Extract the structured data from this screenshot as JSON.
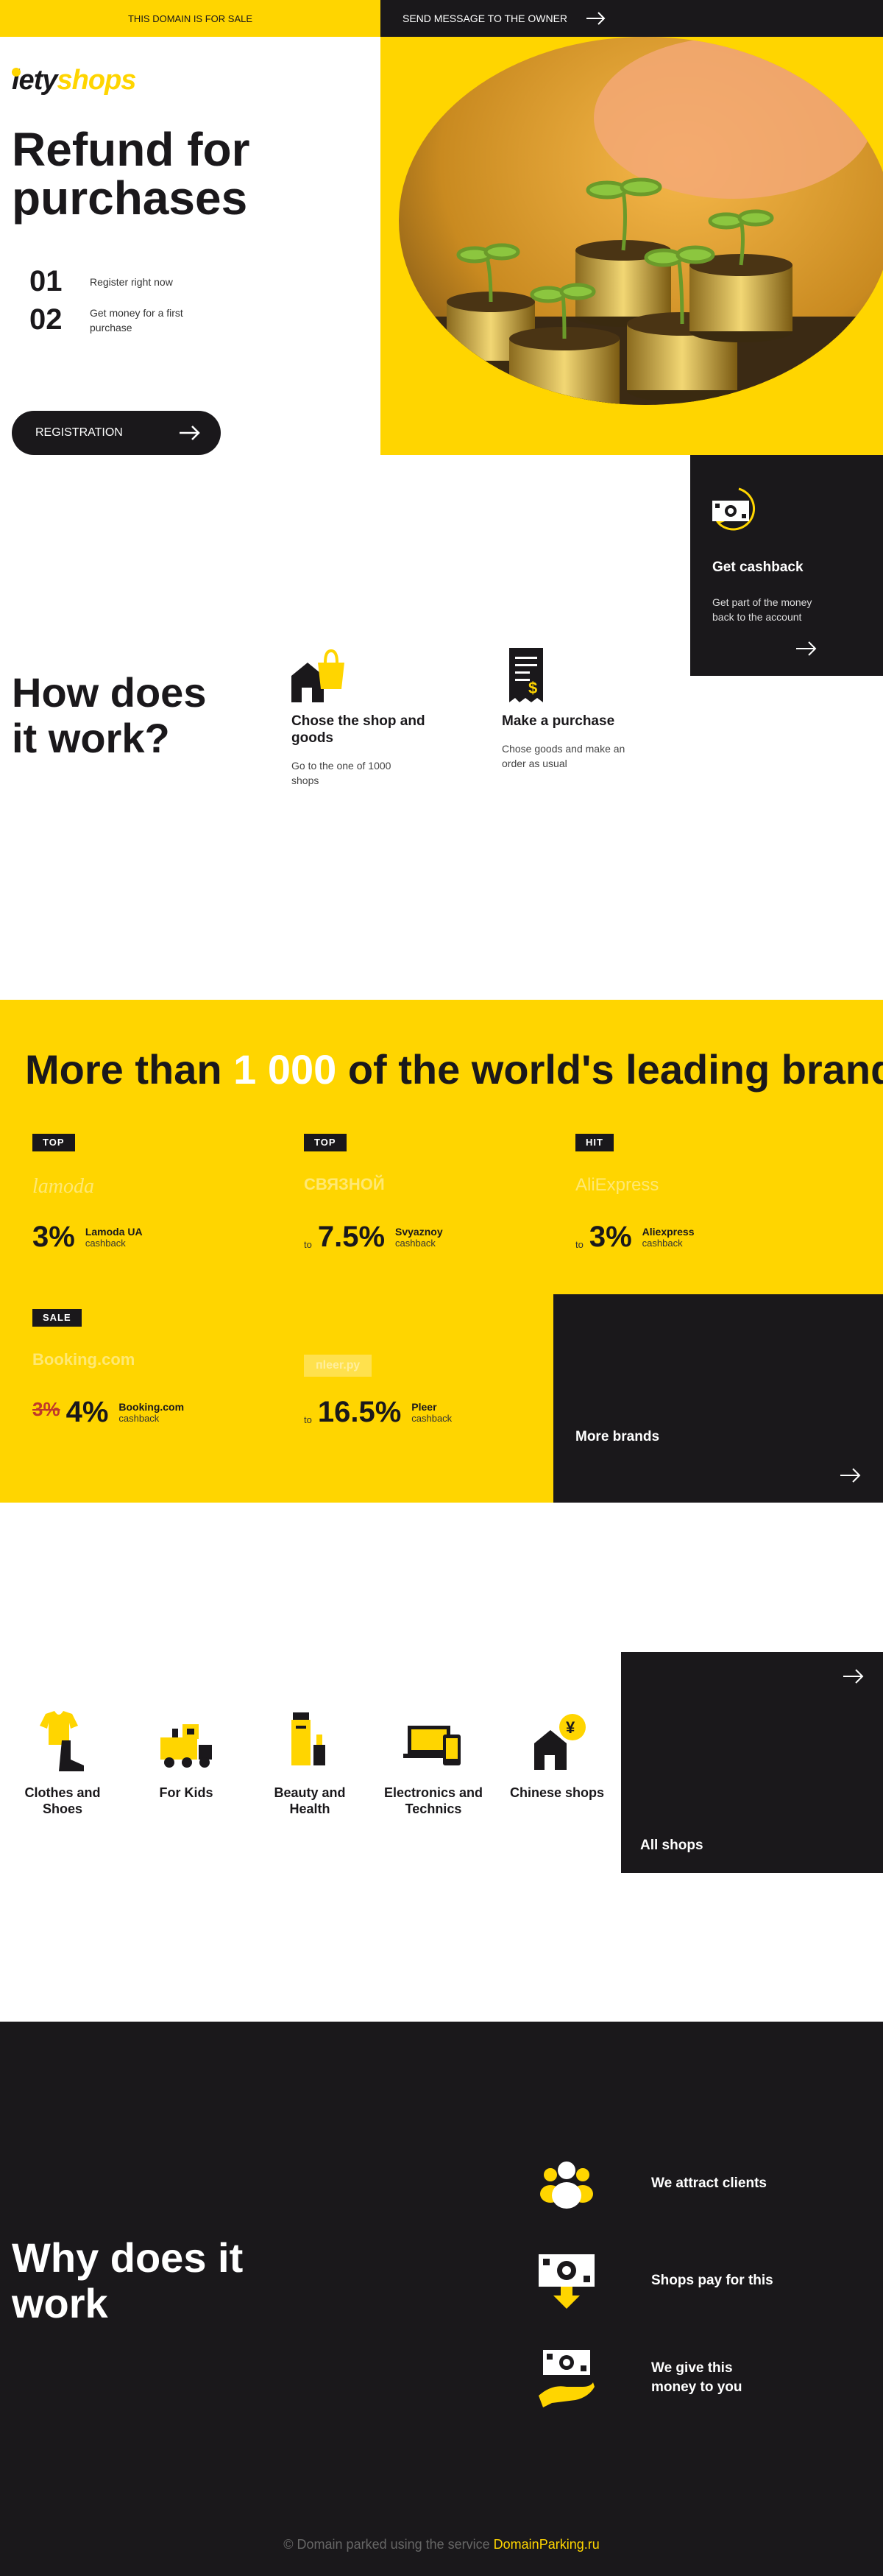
{
  "topbar": {
    "sale_text": "THIS DOMAIN IS FOR SALE",
    "message_text": "SEND MESSAGE TO THE OWNER"
  },
  "logo": {
    "part1": "lety",
    "part2": "shops"
  },
  "hero": {
    "title": "Refund for purchases",
    "steps": [
      {
        "num": "01",
        "text": "Register right now"
      },
      {
        "num": "02",
        "text": "Get money for a first purchase"
      }
    ],
    "button_label": "REGISTRATION"
  },
  "how": {
    "title": "How does it work?",
    "items": [
      {
        "title": "Chose the shop and goods",
        "desc": "Go to the one of 1000 shops"
      },
      {
        "title": "Make a purchase",
        "desc": "Chose goods and make an order as usual"
      },
      {
        "title": "Get cashback",
        "desc": "Get part of the money back to the account"
      }
    ]
  },
  "brands": {
    "title_before": "More than ",
    "title_highlight": "1 000",
    "title_after": " of the world's leading brand",
    "items": [
      {
        "badge": "TOP",
        "logo": "lamoda",
        "to": "",
        "old": "",
        "pct": "3%",
        "name": "Lamoda UA",
        "cashback": "cashback"
      },
      {
        "badge": "TOP",
        "logo": "СВЯЗНОЙ",
        "to": "to",
        "old": "",
        "pct": "7.5%",
        "name": "Svyaznoy",
        "cashback": "cashback"
      },
      {
        "badge": "HIT",
        "logo": "AliExpress",
        "to": "to",
        "old": "",
        "pct": "3%",
        "name": "Aliexpress",
        "cashback": "cashback"
      },
      {
        "badge": "SALE",
        "logo": "Booking.com",
        "to": "",
        "old": "3%",
        "pct": "4%",
        "name": "Booking.com",
        "cashback": "cashback"
      },
      {
        "badge": "",
        "logo": "пleer.ру",
        "to": "to",
        "old": "",
        "pct": "16.5%",
        "name": "Pleer",
        "cashback": "cashback"
      }
    ],
    "more_label": "More brands"
  },
  "categories": {
    "items": [
      {
        "label": "Clothes and Shoes",
        "icon": "clothes-icon"
      },
      {
        "label": "For Kids",
        "icon": "train-icon"
      },
      {
        "label": "Beauty and Health",
        "icon": "cosmetics-icon"
      },
      {
        "label": "Electronics and Technics",
        "icon": "devices-icon"
      },
      {
        "label": "Chinese shops",
        "icon": "yen-shop-icon"
      }
    ],
    "all_label": "All shops"
  },
  "why": {
    "title": "Why does it work",
    "items": [
      {
        "text": "We attract clients",
        "icon": "people-icon"
      },
      {
        "text": "Shops pay for this",
        "icon": "money-down-icon"
      },
      {
        "text": "We give this money to you",
        "icon": "hand-money-icon"
      }
    ]
  },
  "footer": {
    "text": "© Domain parked using the service ",
    "link": "DomainParking.ru"
  },
  "colors": {
    "accent": "#ffd500",
    "dark": "#1a181b",
    "sale_red": "#c0392b"
  }
}
